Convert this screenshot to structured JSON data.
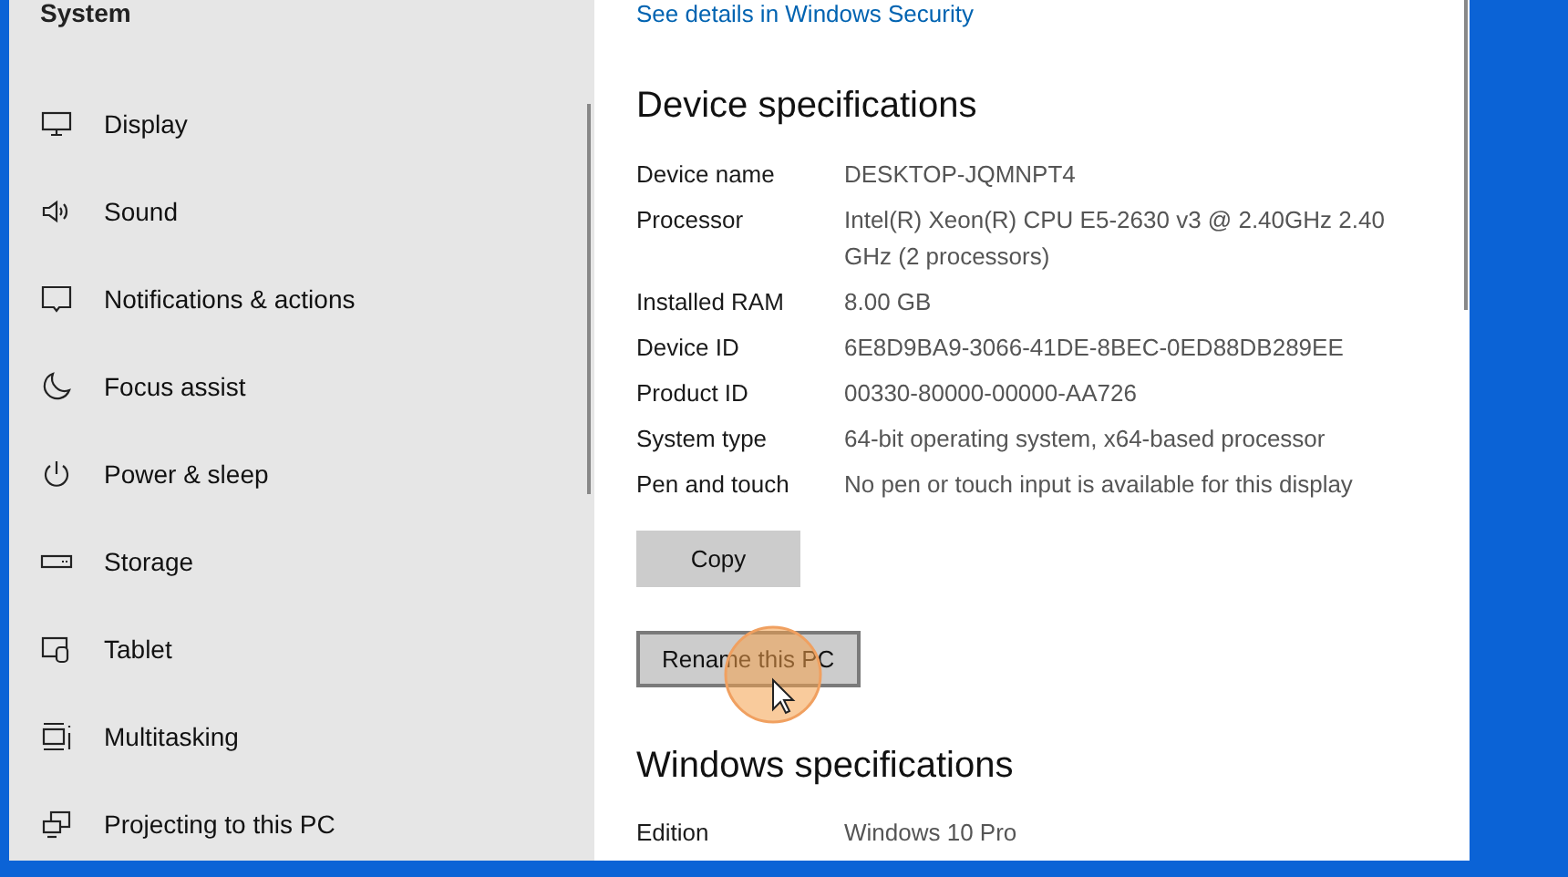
{
  "sidebar": {
    "title": "System",
    "items": [
      {
        "label": "Display"
      },
      {
        "label": "Sound"
      },
      {
        "label": "Notifications & actions"
      },
      {
        "label": "Focus assist"
      },
      {
        "label": "Power & sleep"
      },
      {
        "label": "Storage"
      },
      {
        "label": "Tablet"
      },
      {
        "label": "Multitasking"
      },
      {
        "label": "Projecting to this PC"
      }
    ]
  },
  "content": {
    "link": "See details in Windows Security",
    "device_heading": "Device specifications",
    "device_specs": [
      {
        "label": "Device name",
        "value": "DESKTOP-JQMNPT4"
      },
      {
        "label": "Processor",
        "value": "Intel(R) Xeon(R) CPU E5-2630 v3 @ 2.40GHz   2.40 GHz  (2 processors)"
      },
      {
        "label": "Installed RAM",
        "value": "8.00 GB"
      },
      {
        "label": "Device ID",
        "value": "6E8D9BA9-3066-41DE-8BEC-0ED88DB289EE"
      },
      {
        "label": "Product ID",
        "value": "00330-80000-00000-AA726"
      },
      {
        "label": "System type",
        "value": "64-bit operating system, x64-based processor"
      },
      {
        "label": "Pen and touch",
        "value": "No pen or touch input is available for this display"
      }
    ],
    "buttons": [
      {
        "label": "Copy",
        "focused": false
      },
      {
        "label": "Rename this PC",
        "focused": true
      }
    ],
    "windows_heading": "Windows specifications",
    "windows_specs": [
      {
        "label": "Edition",
        "value": "Windows 10 Pro"
      }
    ]
  }
}
